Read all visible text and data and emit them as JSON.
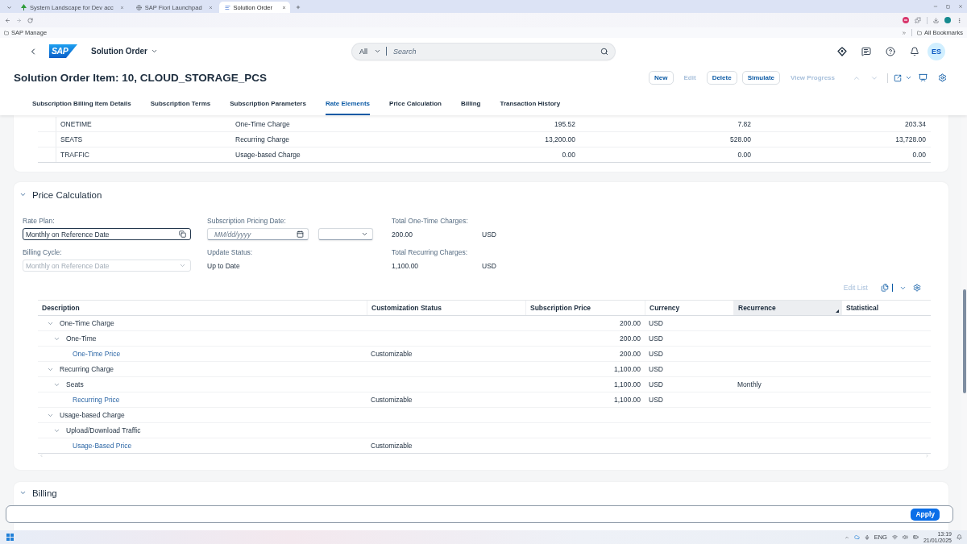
{
  "browser": {
    "tabs": [
      {
        "title": "System Landscape for Dev acc",
        "selected": false
      },
      {
        "title": "SAP Fiori Launchpad",
        "selected": false
      },
      {
        "title": "Solution Order",
        "selected": true
      }
    ],
    "bookmarks": [
      {
        "label": "SAP Manage"
      }
    ],
    "all_bookmarks": "All Bookmarks"
  },
  "shell": {
    "logo": "SAP",
    "app_title": "Solution Order",
    "search": {
      "scope": "All",
      "placeholder": "Search"
    },
    "avatar": "ES"
  },
  "object_header": {
    "title": "Solution Order Item: 10, CLOUD_STORAGE_PCS",
    "actions": [
      {
        "label": "New",
        "disabled": false
      },
      {
        "label": "Edit",
        "disabled": true
      },
      {
        "label": "Delete",
        "disabled": false
      },
      {
        "label": "Simulate",
        "disabled": false
      },
      {
        "label": "View Progress",
        "disabled": true
      }
    ],
    "item_navigation": {
      "disabled": true
    }
  },
  "tabs": [
    {
      "label": "Subscription Billing Item Details",
      "selected": false
    },
    {
      "label": "Subscription Terms",
      "selected": false
    },
    {
      "label": "Subscription Parameters",
      "selected": false
    },
    {
      "label": "Rate Elements",
      "selected": true
    },
    {
      "label": "Price Calculation",
      "selected": false
    },
    {
      "label": "Billing",
      "selected": false
    },
    {
      "label": "Transaction History",
      "selected": false
    }
  ],
  "rate_elements": {
    "rows": [
      {
        "cells": [
          "ONETIME",
          "One-Time Charge",
          "195.52",
          "7.82",
          "203.34"
        ]
      },
      {
        "cells": [
          "SEATS",
          "Recurring Charge",
          "13,200.00",
          "528.00",
          "13,728.00"
        ]
      },
      {
        "cells": [
          "TRAFFIC",
          "Usage-based Charge",
          "0.00",
          "0.00",
          "0.00"
        ]
      }
    ]
  },
  "price_calculation": {
    "title": "Price Calculation",
    "expanded": true,
    "fields": [
      {
        "kind": "value_help",
        "label": "Rate Plan:",
        "value": "Monthly on Reference Date",
        "focused": true,
        "disabled": false
      },
      {
        "kind": "date",
        "label": "Subscription Pricing Date:",
        "placeholder": "MM/dd/yyyy",
        "focused": false,
        "disabled": false
      },
      {
        "kind": "amount",
        "label": "Total One-Time Charges:",
        "value": "200.00",
        "currency": "USD"
      },
      {
        "kind": "select",
        "label": "Billing Cycle:",
        "value": "Monthly on Reference Date",
        "focused": false,
        "disabled": true
      },
      {
        "kind": "text",
        "label": "Update Status:",
        "value": "Up to Date"
      },
      {
        "kind": "amount",
        "label": "Total Recurring Charges:",
        "value": "1,100.00",
        "currency": "USD"
      }
    ],
    "table": {
      "edit_list": {
        "label": "Edit List",
        "disabled": true
      },
      "columns": [
        {
          "label": "Description",
          "selected": false
        },
        {
          "label": "Customization Status",
          "selected": false
        },
        {
          "label": "Subscription Price",
          "selected": false
        },
        {
          "label": "Currency",
          "selected": false
        },
        {
          "label": "Recurrence",
          "selected": true
        },
        {
          "label": "Statistical",
          "selected": false
        }
      ],
      "rows": [
        {
          "description": "One-Time Charge",
          "subscription_price": "200.00",
          "currency": "USD",
          "expanded": true,
          "children": [
            {
              "description": "One-Time",
              "subscription_price": "200.00",
              "currency": "USD",
              "expanded": true,
              "children": [
                {
                  "description": "One-Time Price",
                  "customization_status": "Customizable",
                  "subscription_price": "200.00",
                  "currency": "USD"
                }
              ]
            }
          ]
        },
        {
          "description": "Recurring Charge",
          "subscription_price": "1,100.00",
          "currency": "USD",
          "expanded": true,
          "children": [
            {
              "description": "Seats",
              "subscription_price": "1,100.00",
              "currency": "USD",
              "recurrence": "Monthly",
              "expanded": true,
              "children": [
                {
                  "description": "Recurring Price",
                  "customization_status": "Customizable",
                  "subscription_price": "1,100.00",
                  "currency": "USD"
                }
              ]
            }
          ]
        },
        {
          "description": "Usage-based Charge",
          "expanded": true,
          "children": [
            {
              "description": "Upload/Download Traffic",
              "expanded": true,
              "children": [
                {
                  "description": "Usage-Based Price",
                  "customization_status": "Customizable"
                }
              ]
            }
          ]
        }
      ]
    }
  },
  "billing": {
    "title": "Billing",
    "expanded": true
  },
  "footer": {
    "apply": "Apply"
  },
  "taskbar": {
    "language": "ENG",
    "time": "13:19",
    "date": "21/01/2025"
  }
}
